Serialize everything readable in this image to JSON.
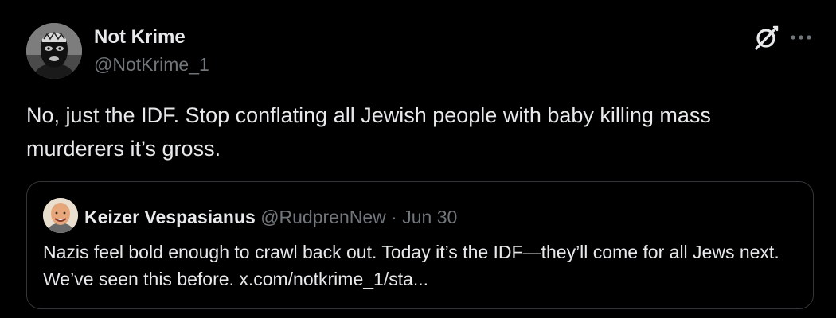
{
  "tweet": {
    "author": {
      "display_name": "Not Krime",
      "handle": "@NotKrime_1",
      "avatar_icon": "masked-avatar"
    },
    "text": "No, just the IDF. Stop conflating all Jewish people with baby killing mass murderers it’s gross.",
    "actions": {
      "grok_icon": "grok-icon",
      "more_icon": "more-horizontal-icon"
    }
  },
  "quoted_tweet": {
    "author": {
      "display_name": "Keizer Vespasianus",
      "handle": "@RudprenNew",
      "avatar_icon": "smiling-man-avatar"
    },
    "separator": "·",
    "date": "Jun 30",
    "text": "Nazis feel bold enough to crawl back out. Today it’s the IDF—they’ll come for all Jews next. We’ve seen this before. x.com/notkrime_1/sta..."
  },
  "colors": {
    "background": "#000000",
    "primary_text": "#e7e9ea",
    "secondary_text": "#71767b",
    "border": "#333639"
  }
}
